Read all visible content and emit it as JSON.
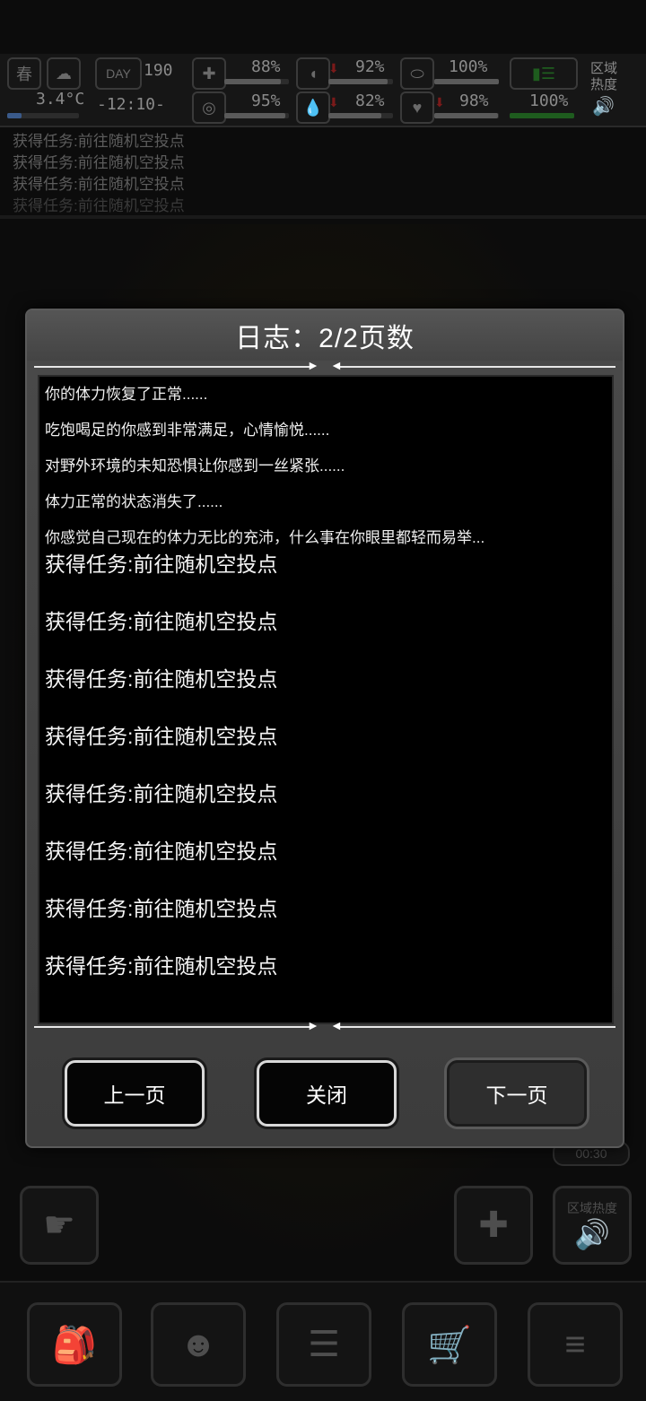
{
  "hud": {
    "season": "春",
    "day_label": "DAY",
    "day": "190",
    "temperature": "3.4°C",
    "time": "-12:10-",
    "stats": [
      {
        "name": "health",
        "value": "88%"
      },
      {
        "name": "hunger",
        "value": "92%"
      },
      {
        "name": "medicine",
        "value": "100%"
      },
      {
        "name": "sanity",
        "value": "95%"
      },
      {
        "name": "thirst",
        "value": "82%"
      },
      {
        "name": "heart",
        "value": "98%"
      },
      {
        "name": "stamina",
        "value": "100%"
      }
    ],
    "zone_heat_label": "区域热度"
  },
  "message_log": [
    "获得任务:前往随机空投点",
    "获得任务:前往随机空投点",
    "获得任务:前往随机空投点",
    "获得任务:前往随机空投点"
  ],
  "dialog": {
    "title": "日志：2/2页数",
    "entries_small": [
      "你的体力恢复了正常......",
      "吃饱喝足的你感到非常满足，心情愉悦......",
      "对野外环境的未知恐惧让你感到一丝紧张......",
      "体力正常的状态消失了......",
      "你感觉自己现在的体力无比的充沛，什么事在你眼里都轻而易举..."
    ],
    "entries_large": [
      "获得任务:前往随机空投点",
      "获得任务:前往随机空投点",
      "获得任务:前往随机空投点",
      "获得任务:前往随机空投点",
      "获得任务:前往随机空投点",
      "获得任务:前往随机空投点",
      "获得任务:前往随机空投点",
      "获得任务:前往随机空投点"
    ],
    "prev_label": "上一页",
    "close_label": "关闭",
    "next_label": "下一页"
  },
  "background": {
    "zone_heat_button_label": "区域热度",
    "timer": "00:30"
  }
}
